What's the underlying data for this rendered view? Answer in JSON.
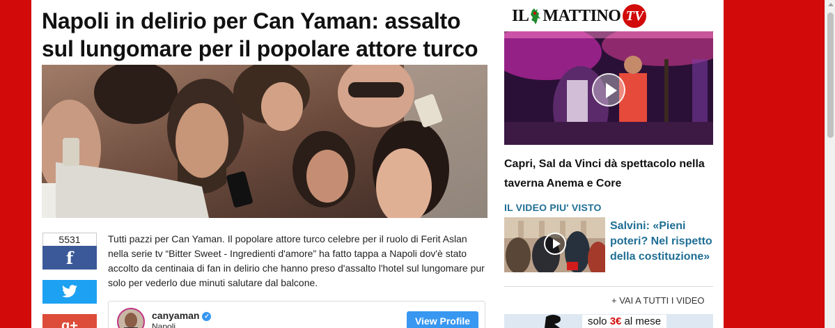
{
  "article": {
    "headline": "Napoli in delirio per Can Yaman: assalto sul lungomare per il popolare attore turco",
    "body": "Tutti pazzi per Can Yaman. Il popolare attore turco celebre per il ruolo di Ferit Aslan nella serie tv “Bitter Sweet - Ingredienti d'amore” ha fatto tappa a Napoli dov'è stato accolto da centinaia di fan in delirio che hanno preso d'assalto l'hotel sul lungomare pur solo per vederlo due minuti salutare dal balcone."
  },
  "share": {
    "count": "5531",
    "facebook_icon": "f",
    "twitter_icon": "twitter-bird-icon",
    "googleplus_icon": "g+"
  },
  "instagram": {
    "username": "canyaman",
    "location": "Napoli",
    "verified_mark": "✓",
    "button_label": "View Profile"
  },
  "sidebar": {
    "brand_left": "IL",
    "brand_right": "MATTINO",
    "brand_tv": "TV",
    "main_video_title": "Capri, Sal da Vinci dà spettacolo nella taverna Anema e Core",
    "most_viewed_label": "IL VIDEO PIU' VISTO",
    "most_viewed_title": "Salvini: «Pieni poteri? Nel rispetto della costituzione»",
    "all_videos_link": "+ VAI A TUTTI I VIDEO",
    "promo_text_prefix": "solo ",
    "promo_price": "3€",
    "promo_text_suffix": " al mese"
  },
  "colors": {
    "site_background": "#d20a0a",
    "link_blue": "#1f6e94",
    "facebook": "#3b5998",
    "twitter": "#1da1f2",
    "googleplus": "#dd4b39",
    "instagram_button": "#3897f0"
  }
}
